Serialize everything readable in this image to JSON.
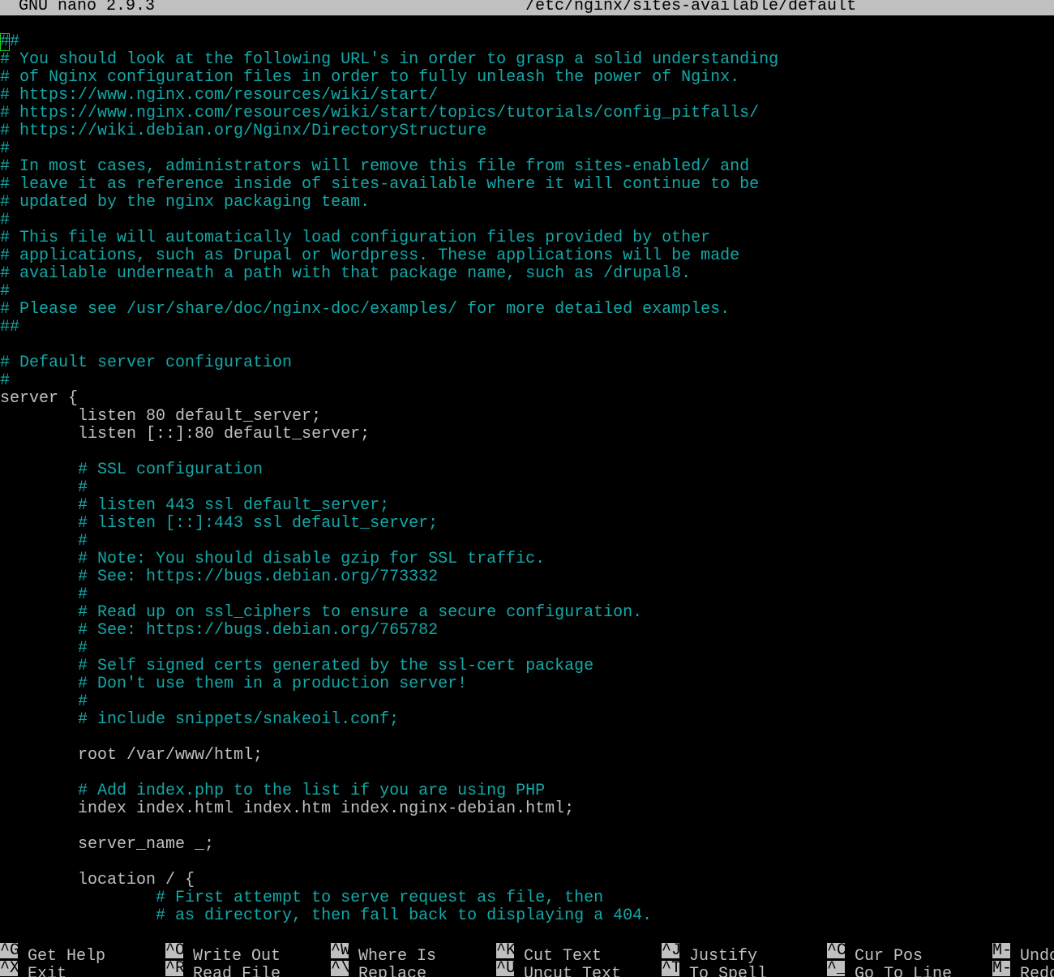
{
  "titlebar": {
    "version": "GNU nano 2.9.3",
    "filename": "/etc/nginx/sites-available/default"
  },
  "editor": {
    "lines": [
      {
        "text": "##",
        "type": "comment"
      },
      {
        "text": "# You should look at the following URL's in order to grasp a solid understanding",
        "type": "comment"
      },
      {
        "text": "# of Nginx configuration files in order to fully unleash the power of Nginx.",
        "type": "comment"
      },
      {
        "text": "# https://www.nginx.com/resources/wiki/start/",
        "type": "comment"
      },
      {
        "text": "# https://www.nginx.com/resources/wiki/start/topics/tutorials/config_pitfalls/",
        "type": "comment"
      },
      {
        "text": "# https://wiki.debian.org/Nginx/DirectoryStructure",
        "type": "comment"
      },
      {
        "text": "#",
        "type": "comment"
      },
      {
        "text": "# In most cases, administrators will remove this file from sites-enabled/ and",
        "type": "comment"
      },
      {
        "text": "# leave it as reference inside of sites-available where it will continue to be",
        "type": "comment"
      },
      {
        "text": "# updated by the nginx packaging team.",
        "type": "comment"
      },
      {
        "text": "#",
        "type": "comment"
      },
      {
        "text": "# This file will automatically load configuration files provided by other",
        "type": "comment"
      },
      {
        "text": "# applications, such as Drupal or Wordpress. These applications will be made",
        "type": "comment"
      },
      {
        "text": "# available underneath a path with that package name, such as /drupal8.",
        "type": "comment"
      },
      {
        "text": "#",
        "type": "comment"
      },
      {
        "text": "# Please see /usr/share/doc/nginx-doc/examples/ for more detailed examples.",
        "type": "comment"
      },
      {
        "text": "##",
        "type": "comment"
      },
      {
        "text": "",
        "type": "code"
      },
      {
        "text": "# Default server configuration",
        "type": "comment"
      },
      {
        "text": "#",
        "type": "comment"
      },
      {
        "text": "server {",
        "type": "code"
      },
      {
        "text": "        listen 80 default_server;",
        "type": "code"
      },
      {
        "text": "        listen [::]:80 default_server;",
        "type": "code"
      },
      {
        "text": "",
        "type": "code"
      },
      {
        "text": "        # SSL configuration",
        "type": "comment"
      },
      {
        "text": "        #",
        "type": "comment"
      },
      {
        "text": "        # listen 443 ssl default_server;",
        "type": "comment"
      },
      {
        "text": "        # listen [::]:443 ssl default_server;",
        "type": "comment"
      },
      {
        "text": "        #",
        "type": "comment"
      },
      {
        "text": "        # Note: You should disable gzip for SSL traffic.",
        "type": "comment"
      },
      {
        "text": "        # See: https://bugs.debian.org/773332",
        "type": "comment"
      },
      {
        "text": "        #",
        "type": "comment"
      },
      {
        "text": "        # Read up on ssl_ciphers to ensure a secure configuration.",
        "type": "comment"
      },
      {
        "text": "        # See: https://bugs.debian.org/765782",
        "type": "comment"
      },
      {
        "text": "        #",
        "type": "comment"
      },
      {
        "text": "        # Self signed certs generated by the ssl-cert package",
        "type": "comment"
      },
      {
        "text": "        # Don't use them in a production server!",
        "type": "comment"
      },
      {
        "text": "        #",
        "type": "comment"
      },
      {
        "text": "        # include snippets/snakeoil.conf;",
        "type": "comment"
      },
      {
        "text": "",
        "type": "code"
      },
      {
        "text": "        root /var/www/html;",
        "type": "code"
      },
      {
        "text": "",
        "type": "code"
      },
      {
        "text": "        # Add index.php to the list if you are using PHP",
        "type": "comment"
      },
      {
        "text": "        index index.html index.htm index.nginx-debian.html;",
        "type": "code"
      },
      {
        "text": "",
        "type": "code"
      },
      {
        "text": "        server_name _;",
        "type": "code"
      },
      {
        "text": "",
        "type": "code"
      },
      {
        "text": "        location / {",
        "type": "code"
      },
      {
        "text": "                # First attempt to serve request as file, then",
        "type": "comment"
      },
      {
        "text": "                # as directory, then fall back to displaying a 404.",
        "type": "comment"
      }
    ]
  },
  "shortcuts": {
    "row1": [
      {
        "key": "^G",
        "label": "Get Help"
      },
      {
        "key": "^O",
        "label": "Write Out"
      },
      {
        "key": "^W",
        "label": "Where Is"
      },
      {
        "key": "^K",
        "label": "Cut Text"
      },
      {
        "key": "^J",
        "label": "Justify"
      },
      {
        "key": "^C",
        "label": "Cur Pos"
      },
      {
        "key": "M-U",
        "label": "Undo"
      }
    ],
    "row2": [
      {
        "key": "^X",
        "label": "Exit"
      },
      {
        "key": "^R",
        "label": "Read File"
      },
      {
        "key": "^\\",
        "label": "Replace"
      },
      {
        "key": "^U",
        "label": "Uncut Text"
      },
      {
        "key": "^T",
        "label": "To Spell"
      },
      {
        "key": "^_",
        "label": "Go To Line"
      },
      {
        "key": "M-E",
        "label": "Redo"
      }
    ]
  },
  "colors": {
    "background": "#000000",
    "comment": "#14a8a8",
    "text": "#c0c0c0",
    "bar": "#c0c0c0",
    "cursor": "#19d119"
  }
}
